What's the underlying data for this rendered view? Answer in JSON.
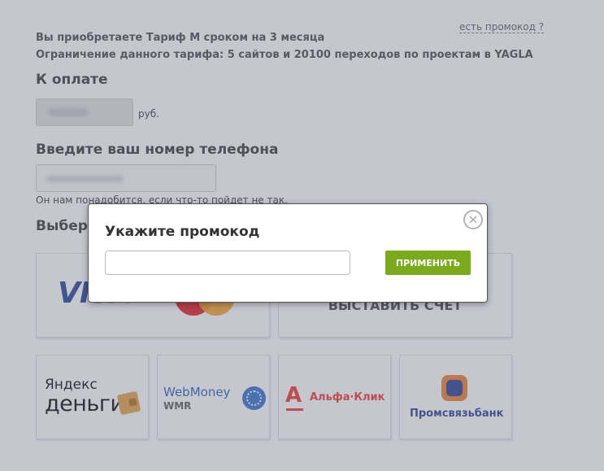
{
  "header": {
    "promo_link": "есть промокод ?",
    "summary_line1": "Вы приобретаете Тариф М сроком на 3 месяца",
    "summary_line2": "Ограничение данного тарифа: 5 сайтов и 20100 переходов по проектам в YAGLA"
  },
  "payment": {
    "heading": "К оплате",
    "currency": "руб."
  },
  "phone": {
    "heading": "Введите ваш номер телефона",
    "hint": "Он нам понадобится, если что-то пойдет не так."
  },
  "methods": {
    "heading": "Выберите способ оплаты",
    "card": {
      "visa": "VISA"
    },
    "invoice": {
      "label": "ВЫСТАВИТЬ СЧЕТ"
    },
    "yandex": {
      "top": "Яндекс",
      "bottom": "деньги"
    },
    "webmoney": {
      "title": "WebMoney",
      "sub": "WMR"
    },
    "alfa": {
      "letter": "А",
      "text": "Альфа·Клик"
    },
    "psb": {
      "text": "Промсвязьбанк"
    }
  },
  "modal": {
    "title": "Укажите промокод",
    "input_value": "",
    "apply_label": "ПРИМЕНИТЬ",
    "close_symbol": "×"
  },
  "colors": {
    "accent_green": "#7caa1e",
    "overlay": "rgba(120,120,140,0.42)"
  }
}
